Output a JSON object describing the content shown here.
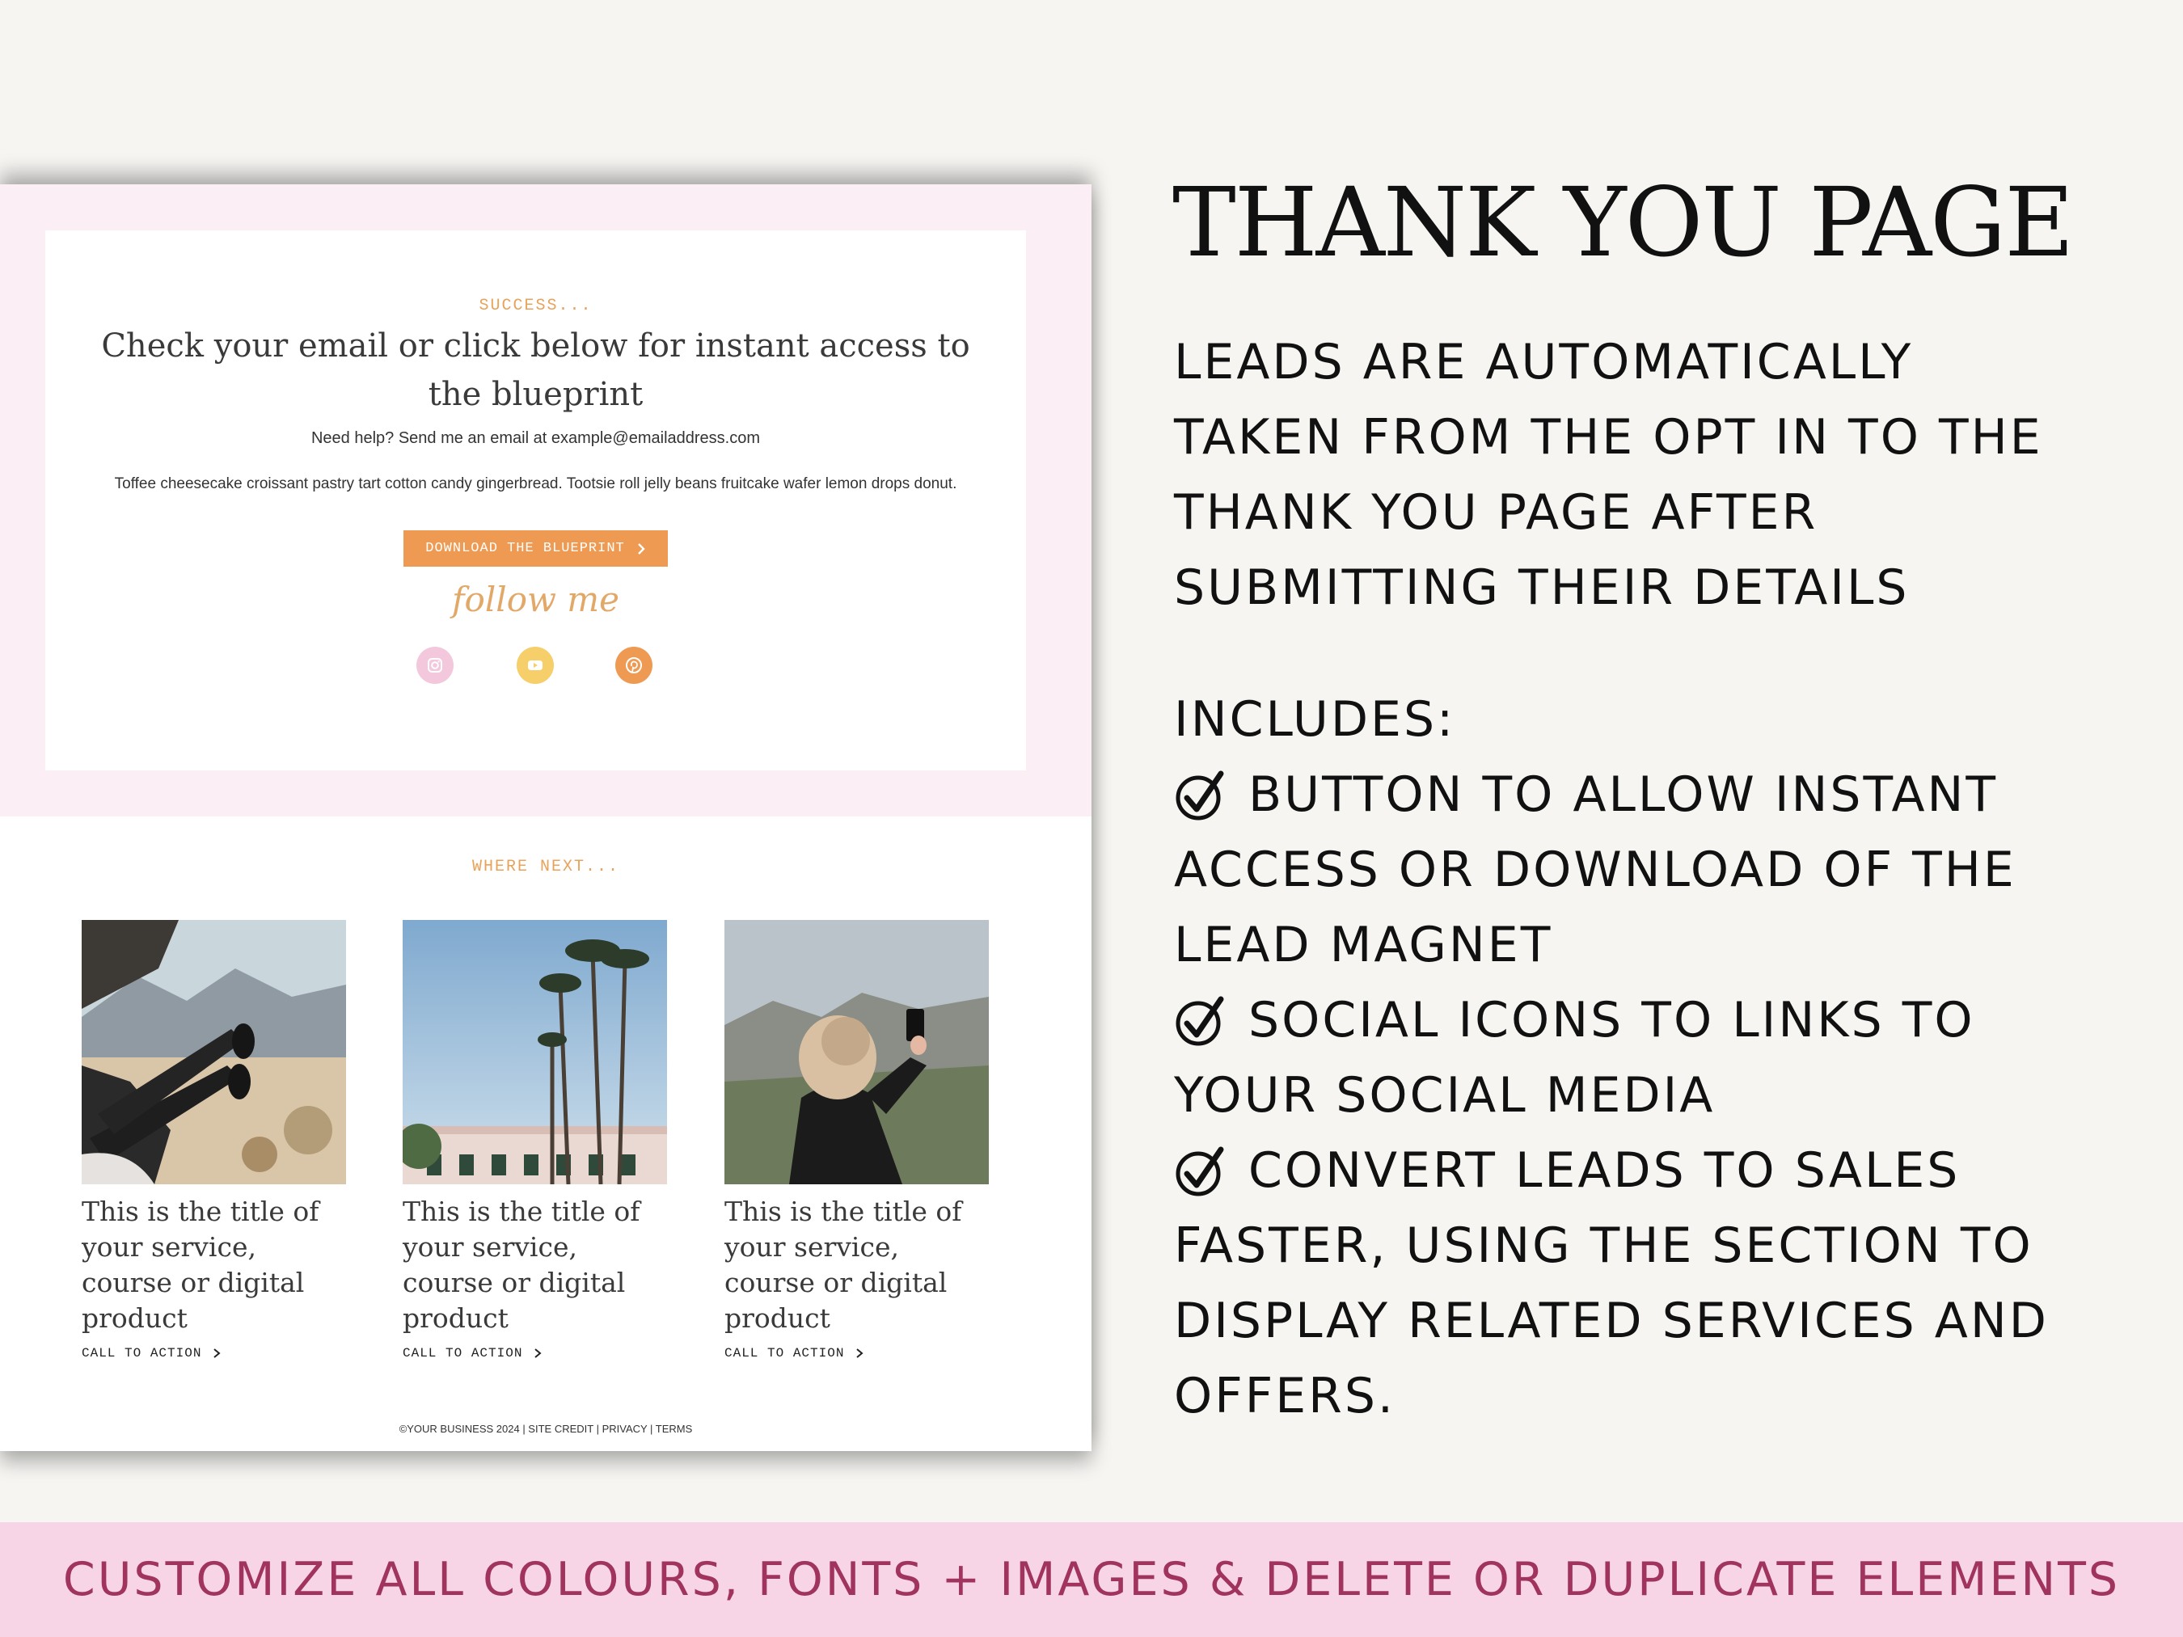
{
  "mockup": {
    "hero": {
      "eyebrow": "SUCCESS...",
      "heading": "Check your email or click below for instant access to the blueprint",
      "help_text": "Need help? Send me an email at example@emailaddress.com",
      "body_text": "Toffee cheesecake croissant pastry tart cotton candy gingerbread. Tootsie roll jelly beans fruitcake wafer lemon drops donut.",
      "button_label": "DOWNLOAD THE BLUEPRINT",
      "follow_label": "follow me",
      "social_icons": [
        "instagram-icon",
        "youtube-icon",
        "pinterest-icon"
      ]
    },
    "where_next": {
      "heading": "WHERE NEXT...",
      "cards": [
        {
          "title": "This is the title of your service, course or digital product",
          "cta": "CALL TO ACTION"
        },
        {
          "title": "This is the title of your service, course or digital product",
          "cta": "CALL TO ACTION"
        },
        {
          "title": "This is the title of your service, course or digital product",
          "cta": "CALL TO ACTION"
        }
      ]
    },
    "footer": "©YOUR BUSINESS 2024 | SITE CREDIT | PRIVACY | TERMS"
  },
  "right": {
    "title": "THANK YOU PAGE",
    "description": [
      "LEADS ARE AUTOMATICALLY",
      "TAKEN FROM THE OPT IN TO THE",
      "THANK YOU PAGE AFTER",
      "SUBMITTING THEIR DETAILS"
    ],
    "includes_label": "INCLUDES:",
    "features": [
      [
        "BUTTON TO ALLOW INSTANT",
        "ACCESS OR DOWNLOAD OF THE",
        "LEAD MAGNET"
      ],
      [
        "SOCIAL ICONS TO LINKS TO",
        "YOUR SOCIAL MEDIA"
      ],
      [
        "CONVERT LEADS TO SALES",
        "FASTER, USING THE SECTION TO",
        "DISPLAY RELATED SERVICES AND",
        "OFFERS."
      ]
    ]
  },
  "banner": "CUSTOMIZE ALL COLOURS, FONTS + IMAGES & DELETE OR DUPLICATE ELEMENTS",
  "colors": {
    "accent_orange": "#ef9a52",
    "hero_pink": "#fbeef4",
    "banner_pink": "#f7d5e7",
    "banner_text": "#a0345f",
    "page_bg": "#f6f5f2"
  }
}
